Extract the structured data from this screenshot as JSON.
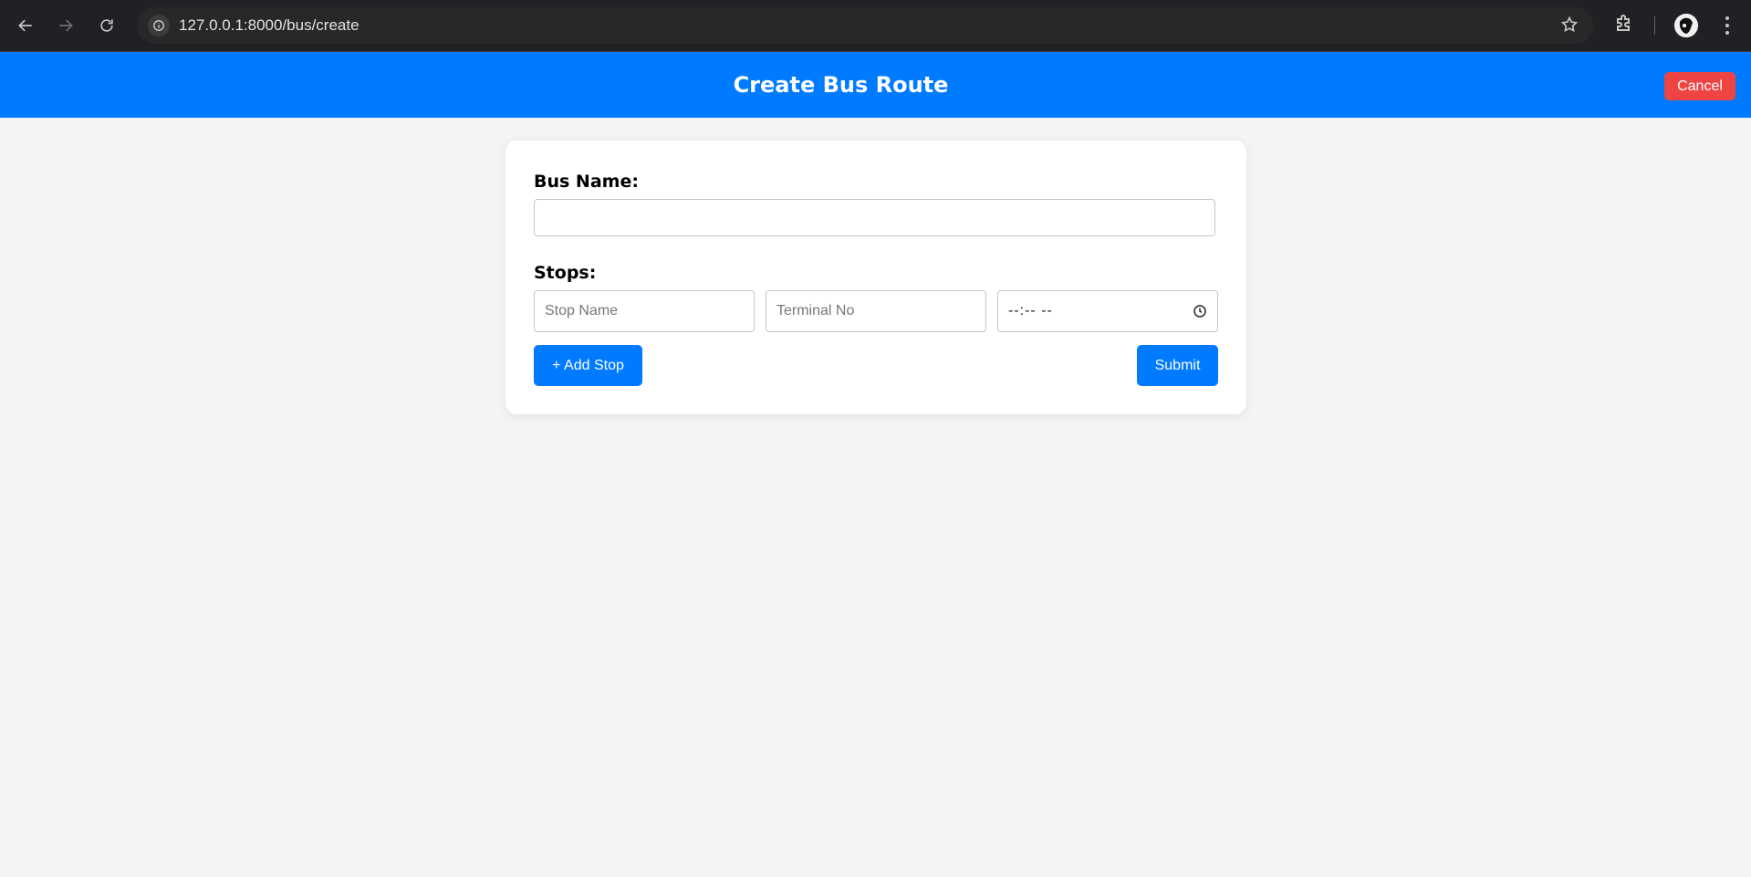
{
  "browser": {
    "url": "127.0.0.1:8000/bus/create",
    "icons": {
      "back": "arrow-left-icon",
      "forward": "arrow-right-icon",
      "reload": "reload-icon",
      "site_info": "info-icon",
      "bookmark": "star-icon",
      "extensions": "puzzle-icon",
      "menu": "kebab-menu-icon"
    }
  },
  "header": {
    "title": "Create Bus Route",
    "cancel_label": "Cancel",
    "colors": {
      "background": "#007bff",
      "cancel": "#ef4444"
    }
  },
  "form": {
    "bus_name_label": "Bus Name:",
    "bus_name_value": "",
    "stops_label": "Stops:",
    "stop": {
      "name_placeholder": "Stop Name",
      "terminal_placeholder": "Terminal No",
      "time_display": "--:-- --"
    },
    "add_stop_label": "+ Add Stop",
    "submit_label": "Submit",
    "accent_color": "#007bff"
  }
}
